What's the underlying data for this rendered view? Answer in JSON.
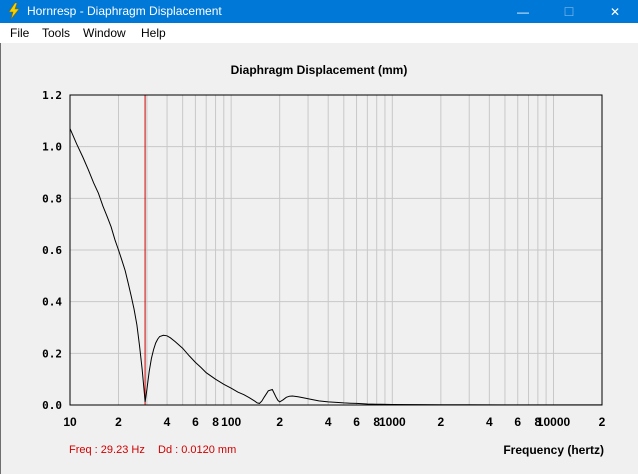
{
  "window": {
    "title": "Hornresp - Diaphragm Displacement",
    "min_glyph": "—",
    "max_glyph": "☐",
    "close_glyph": "✕"
  },
  "menu": {
    "items": [
      "File",
      "Tools",
      "Window",
      "Help"
    ]
  },
  "status": {
    "freq_text": "Freq : 29.23 Hz",
    "dd_text": "Dd : 0.0120 mm"
  },
  "colors": {
    "titlebar": "#0078d7",
    "cursor": "#d00000",
    "curve": "#000000",
    "grid": "#c8c8c8"
  },
  "chart_data": {
    "type": "line",
    "title": "Diaphragm Displacement (mm)",
    "xlabel": "Frequency (hertz)",
    "ylabel": "",
    "x_scale": "log",
    "xlim": [
      10,
      20000
    ],
    "ylim": [
      0,
      1.2
    ],
    "grid": true,
    "yticks": [
      "0.0",
      "0.2",
      "0.4",
      "0.6",
      "0.8",
      "1.0",
      "1.2"
    ],
    "xticks": [
      {
        "v": 10,
        "label": "10"
      },
      {
        "v": 20,
        "label": "2"
      },
      {
        "v": 40,
        "label": "4"
      },
      {
        "v": 60,
        "label": "6"
      },
      {
        "v": 80,
        "label": "8"
      },
      {
        "v": 100,
        "label": "100"
      },
      {
        "v": 200,
        "label": "2"
      },
      {
        "v": 400,
        "label": "4"
      },
      {
        "v": 600,
        "label": "6"
      },
      {
        "v": 800,
        "label": "8"
      },
      {
        "v": 1000,
        "label": "1000"
      },
      {
        "v": 2000,
        "label": "2"
      },
      {
        "v": 4000,
        "label": "4"
      },
      {
        "v": 6000,
        "label": "6"
      },
      {
        "v": 8000,
        "label": "8"
      },
      {
        "v": 10000,
        "label": "10000"
      },
      {
        "v": 20000,
        "label": "2"
      }
    ],
    "cursor_freq": 29.23,
    "series": [
      {
        "x": [
          10,
          11,
          12,
          13,
          14,
          15,
          16,
          17,
          18,
          19,
          20,
          21,
          22,
          23,
          24,
          25,
          26,
          27,
          28,
          29,
          29.23,
          30,
          31,
          32,
          33,
          34,
          35,
          36,
          38,
          40,
          42,
          45,
          50,
          55,
          60,
          65,
          70,
          80,
          90,
          100,
          110,
          120,
          130,
          140,
          145,
          150,
          155,
          160,
          170,
          180,
          185,
          190,
          195,
          200,
          210,
          220,
          230,
          240,
          260,
          280,
          300,
          350,
          400,
          450,
          500,
          550,
          600,
          700,
          800,
          1000,
          1500,
          2000,
          3000,
          5000,
          10000,
          20000
        ],
        "y": [
          1.07,
          1.01,
          0.96,
          0.91,
          0.86,
          0.82,
          0.77,
          0.73,
          0.69,
          0.64,
          0.6,
          0.56,
          0.52,
          0.47,
          0.42,
          0.37,
          0.31,
          0.23,
          0.14,
          0.04,
          0.012,
          0.06,
          0.13,
          0.18,
          0.215,
          0.24,
          0.255,
          0.265,
          0.27,
          0.268,
          0.26,
          0.245,
          0.22,
          0.19,
          0.165,
          0.145,
          0.125,
          0.1,
          0.08,
          0.065,
          0.05,
          0.04,
          0.028,
          0.015,
          0.008,
          0.006,
          0.015,
          0.03,
          0.055,
          0.06,
          0.045,
          0.03,
          0.018,
          0.012,
          0.02,
          0.03,
          0.034,
          0.035,
          0.032,
          0.028,
          0.024,
          0.016,
          0.012,
          0.01,
          0.008,
          0.007,
          0.006,
          0.004,
          0.003,
          0.002,
          0.0015,
          0.001,
          0.0008,
          0.0005,
          0.0003,
          0.0002
        ]
      }
    ]
  }
}
